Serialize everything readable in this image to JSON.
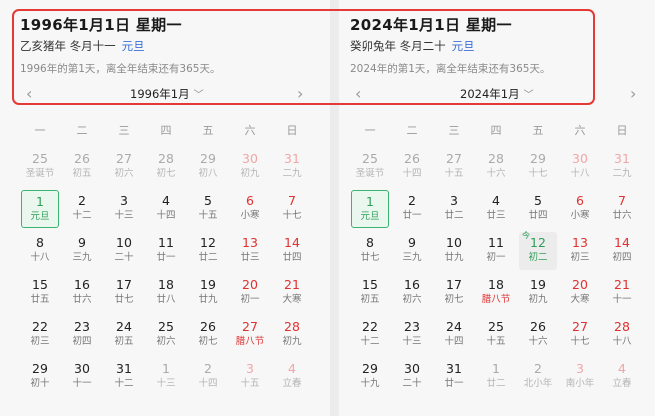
{
  "weekdays": [
    "一",
    "二",
    "三",
    "四",
    "五",
    "六",
    "日"
  ],
  "calendars": [
    {
      "title": "1996年1月1日 星期一",
      "lunar": "乙亥猪年 冬月十一",
      "holiday": "元旦",
      "desc": "1996年的第1天，离全年结束还有365天。",
      "month": "1996年1月",
      "days": [
        [
          [
            "25",
            "圣诞节"
          ],
          [
            "26",
            "初五"
          ],
          [
            "27",
            "初六"
          ],
          [
            "28",
            "初七"
          ],
          [
            "29",
            "初八"
          ],
          [
            "30",
            "初九"
          ],
          [
            "31",
            "二九"
          ]
        ],
        [
          [
            "1",
            "元旦"
          ],
          [
            "2",
            "十二"
          ],
          [
            "3",
            "十三"
          ],
          [
            "4",
            "十四"
          ],
          [
            "5",
            "十五"
          ],
          [
            "6",
            "小寒"
          ],
          [
            "7",
            "十七"
          ]
        ],
        [
          [
            "8",
            "十八"
          ],
          [
            "9",
            "三九"
          ],
          [
            "10",
            "二十"
          ],
          [
            "11",
            "廿一"
          ],
          [
            "12",
            "廿二"
          ],
          [
            "13",
            "廿三"
          ],
          [
            "14",
            "廿四"
          ]
        ],
        [
          [
            "15",
            "廿五"
          ],
          [
            "16",
            "廿六"
          ],
          [
            "17",
            "廿七"
          ],
          [
            "18",
            "廿八"
          ],
          [
            "19",
            "廿九"
          ],
          [
            "20",
            "初一"
          ],
          [
            "21",
            "大寒"
          ]
        ],
        [
          [
            "22",
            "初三"
          ],
          [
            "23",
            "初四"
          ],
          [
            "24",
            "初五"
          ],
          [
            "25",
            "初六"
          ],
          [
            "26",
            "初七"
          ],
          [
            "27",
            "腊八节"
          ],
          [
            "28",
            "初九"
          ]
        ],
        [
          [
            "29",
            "初十"
          ],
          [
            "30",
            "十一"
          ],
          [
            "31",
            "十二"
          ],
          [
            "1",
            "十三"
          ],
          [
            "2",
            "十四"
          ],
          [
            "3",
            "十五"
          ],
          [
            "4",
            "立春"
          ]
        ]
      ]
    },
    {
      "title": "2024年1月1日 星期一",
      "lunar": "癸卯兔年 冬月二十",
      "holiday": "元旦",
      "desc": "2024年的第1天，离全年结束还有365天。",
      "month": "2024年1月",
      "today_label": "今",
      "days": [
        [
          [
            "25",
            "圣诞节"
          ],
          [
            "26",
            "十四"
          ],
          [
            "27",
            "十五"
          ],
          [
            "28",
            "十六"
          ],
          [
            "29",
            "十七"
          ],
          [
            "30",
            "十八"
          ],
          [
            "31",
            "二九"
          ]
        ],
        [
          [
            "1",
            "元旦"
          ],
          [
            "2",
            "廿一"
          ],
          [
            "3",
            "廿二"
          ],
          [
            "4",
            "廿三"
          ],
          [
            "5",
            "廿四"
          ],
          [
            "6",
            "小寒"
          ],
          [
            "7",
            "廿六"
          ]
        ],
        [
          [
            "8",
            "廿七"
          ],
          [
            "9",
            "三九"
          ],
          [
            "10",
            "廿九"
          ],
          [
            "11",
            "初一"
          ],
          [
            "12",
            "初二"
          ],
          [
            "13",
            "初三"
          ],
          [
            "14",
            "初四"
          ]
        ],
        [
          [
            "15",
            "初五"
          ],
          [
            "16",
            "初六"
          ],
          [
            "17",
            "初七"
          ],
          [
            "18",
            "腊八节"
          ],
          [
            "19",
            "初九"
          ],
          [
            "20",
            "大寒"
          ],
          [
            "21",
            "十一"
          ]
        ],
        [
          [
            "22",
            "十二"
          ],
          [
            "23",
            "十三"
          ],
          [
            "24",
            "十四"
          ],
          [
            "25",
            "十五"
          ],
          [
            "26",
            "十六"
          ],
          [
            "27",
            "十七"
          ],
          [
            "28",
            "十八"
          ]
        ],
        [
          [
            "29",
            "十九"
          ],
          [
            "30",
            "二十"
          ],
          [
            "31",
            "廿一"
          ],
          [
            "1",
            "廿二"
          ],
          [
            "2",
            "北小年"
          ],
          [
            "3",
            "南小年"
          ],
          [
            "4",
            "立春"
          ]
        ]
      ]
    }
  ],
  "icons": {
    "prev": "chevron-left-icon",
    "next": "chevron-right-icon",
    "dropdown": "chevron-down-icon"
  },
  "colors": {
    "weekend": "#e03131",
    "selected": "#3cb371",
    "holiday": "#3b6fd6",
    "highlight_border": "#e53935"
  }
}
